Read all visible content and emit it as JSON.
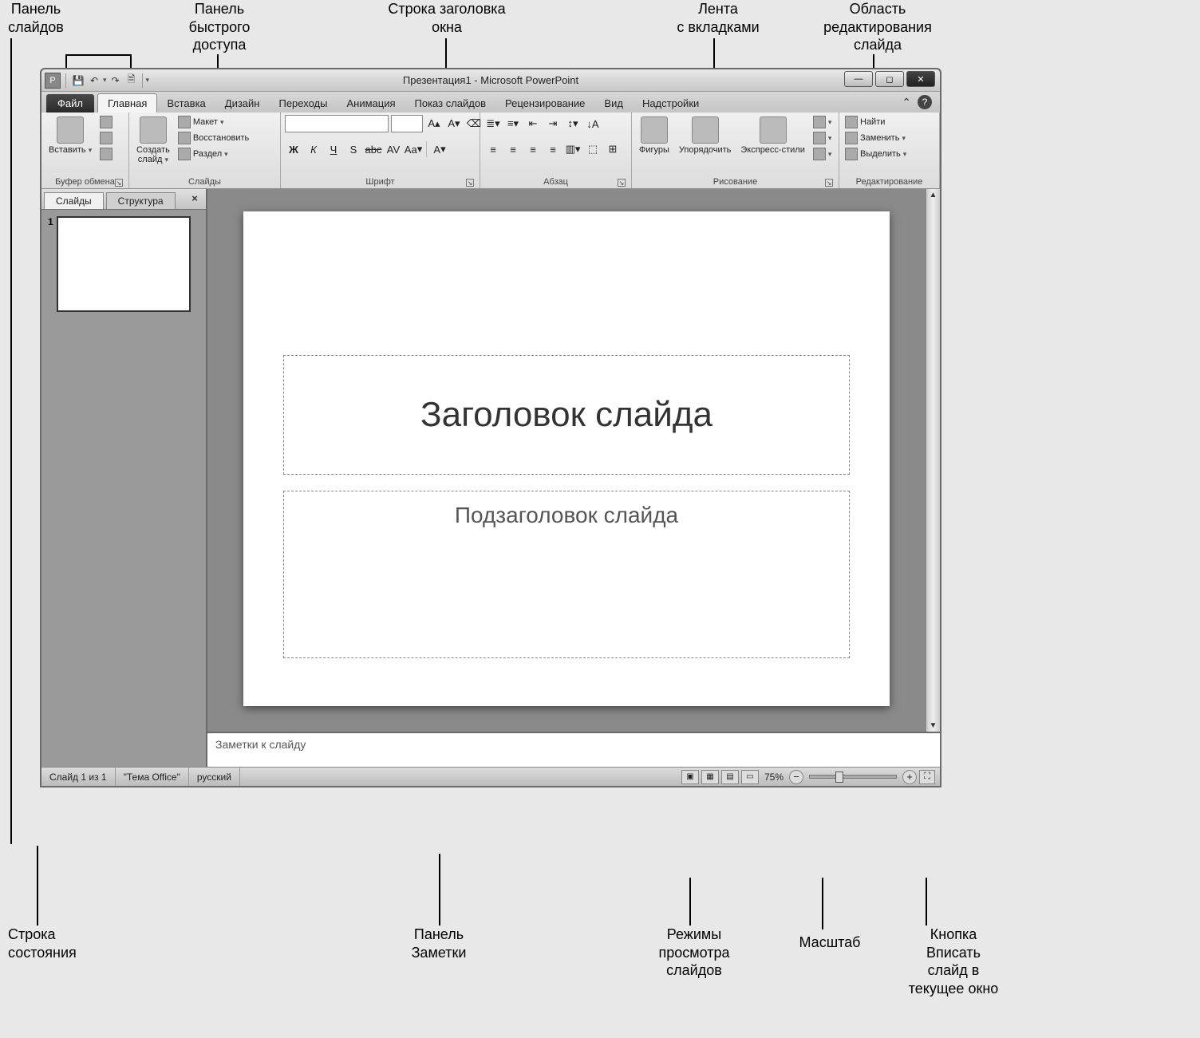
{
  "annotations": {
    "slides_panel": "Панель\nслайдов",
    "qat": "Панель\nбыстрого\nдоступа",
    "title_bar": "Строка заголовка\nокна",
    "ribbon_tabs": "Лента\nс вкладками",
    "edit_area": "Область\nредактирования\nслайда",
    "status_bar": "Строка\nсостояния",
    "notes_panel": "Панель\nЗаметки",
    "view_modes": "Режимы\nпросмотра\nслайдов",
    "zoom": "Масштаб",
    "fit": "Кнопка\nВписать\nслайд в\nтекущее окно"
  },
  "title": {
    "doc": "Презентация1",
    "sep": " - ",
    "app": "Microsoft PowerPoint"
  },
  "tabs": {
    "file": "Файл",
    "items": [
      "Главная",
      "Вставка",
      "Дизайн",
      "Переходы",
      "Анимация",
      "Показ слайдов",
      "Рецензирование",
      "Вид",
      "Надстройки"
    ],
    "active_index": 0
  },
  "ribbon": {
    "clipboard": {
      "label": "Буфер обмена",
      "paste": "Вставить"
    },
    "slides": {
      "label": "Слайды",
      "new": "Создать\nслайд",
      "layout": "Макет",
      "reset": "Восстановить",
      "section": "Раздел"
    },
    "font": {
      "label": "Шрифт",
      "bold": "Ж",
      "italic": "К",
      "underline": "Ч",
      "strike": "abc",
      "shadow": "S",
      "spacing": "AV",
      "case": "Aa",
      "clear": "A"
    },
    "para": {
      "label": "Абзац"
    },
    "drawing": {
      "label": "Рисование",
      "shapes": "Фигуры",
      "arrange": "Упорядочить",
      "styles": "Экспресс-стили"
    },
    "editing": {
      "label": "Редактирование",
      "find": "Найти",
      "replace": "Заменить",
      "select": "Выделить"
    }
  },
  "panel_tabs": {
    "slides": "Слайды",
    "outline": "Структура"
  },
  "thumb_number": "1",
  "placeholders": {
    "title": "Заголовок слайда",
    "subtitle": "Подзаголовок слайда"
  },
  "notes_placeholder": "Заметки к слайду",
  "status": {
    "slide": "Слайд 1 из 1",
    "theme": "\"Тема Office\"",
    "lang": "русский",
    "zoom": "75%"
  }
}
